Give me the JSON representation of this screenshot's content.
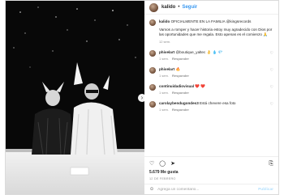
{
  "header": {
    "username": "kalido",
    "separator": "•",
    "follow_label": "Seguir"
  },
  "caption": {
    "username": "kalido",
    "text": "OFICIALMENTE EN LA FAMILIA @kingsrecords",
    "body": "Vamos a romper y hacer historia estoy muy agradecido con Dios por las oportunidades que me regala. Esto apenas es el comienzo 🙏",
    "time": "12 sem."
  },
  "comments": [
    {
      "username": "phivelart",
      "text": "@boutique_yaltec 👌 💧 💎",
      "time": "1 sem.",
      "likes": "",
      "reply": "Responder"
    },
    {
      "username": "phivelart",
      "text": "🔥",
      "time": "1 sem.",
      "likes": "",
      "reply": "Responder"
    },
    {
      "username": "continuidadiovisual",
      "text": "❤️ ❤️",
      "time": "1 sem.",
      "likes": "",
      "reply": "Responder"
    },
    {
      "username": "carolaybendugondes3",
      "text": "Está chevere esa foto",
      "time": "1 sem.",
      "likes": "",
      "reply": "Responder"
    }
  ],
  "icons": {
    "heart": "heart-icon",
    "comment": "comment-icon",
    "share": "share-icon",
    "bookmark": "bookmark-icon",
    "emoji": "emoji-icon",
    "next": "chevron-right-icon"
  },
  "likes": "5.679 Me gusta",
  "date": "12 DE FEBRERO",
  "add_comment": {
    "placeholder": "Agrega un comentario...",
    "publish_label": "Publicar"
  }
}
